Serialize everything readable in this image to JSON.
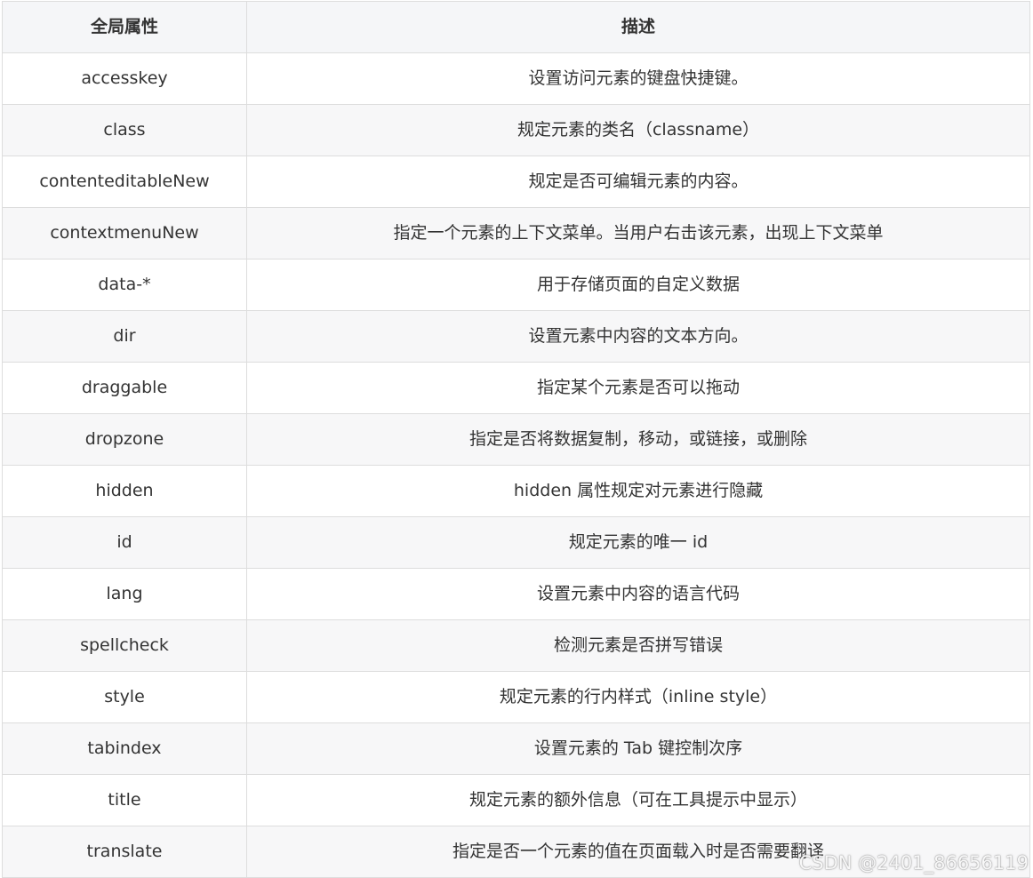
{
  "table": {
    "headers": {
      "attribute": "全局属性",
      "description": "描述"
    },
    "rows": [
      {
        "attribute": "accesskey",
        "description": "设置访问元素的键盘快捷键。"
      },
      {
        "attribute": "class",
        "description": "规定元素的类名（classname）"
      },
      {
        "attribute": "contenteditableNew",
        "description": "规定是否可编辑元素的内容。"
      },
      {
        "attribute": "contextmenuNew",
        "description": "指定一个元素的上下文菜单。当用户右击该元素，出现上下文菜单"
      },
      {
        "attribute": "data-*",
        "description": "用于存储页面的自定义数据"
      },
      {
        "attribute": "dir",
        "description": "设置元素中内容的文本方向。"
      },
      {
        "attribute": "draggable",
        "description": "指定某个元素是否可以拖动"
      },
      {
        "attribute": "dropzone",
        "description": "指定是否将数据复制，移动，或链接，或删除"
      },
      {
        "attribute": "hidden",
        "description": "hidden 属性规定对元素进行隐藏"
      },
      {
        "attribute": "id",
        "description": "规定元素的唯一 id"
      },
      {
        "attribute": "lang",
        "description": "设置元素中内容的语言代码"
      },
      {
        "attribute": "spellcheck",
        "description": "检测元素是否拼写错误"
      },
      {
        "attribute": "style",
        "description": "规定元素的行内样式（inline style）"
      },
      {
        "attribute": "tabindex",
        "description": "设置元素的 Tab 键控制次序"
      },
      {
        "attribute": "title",
        "description": "规定元素的额外信息（可在工具提示中显示）"
      },
      {
        "attribute": "translate",
        "description": "指定是否一个元素的值在页面载入时是否需要翻译"
      }
    ]
  },
  "watermark": "CSDN @2401_86656119"
}
